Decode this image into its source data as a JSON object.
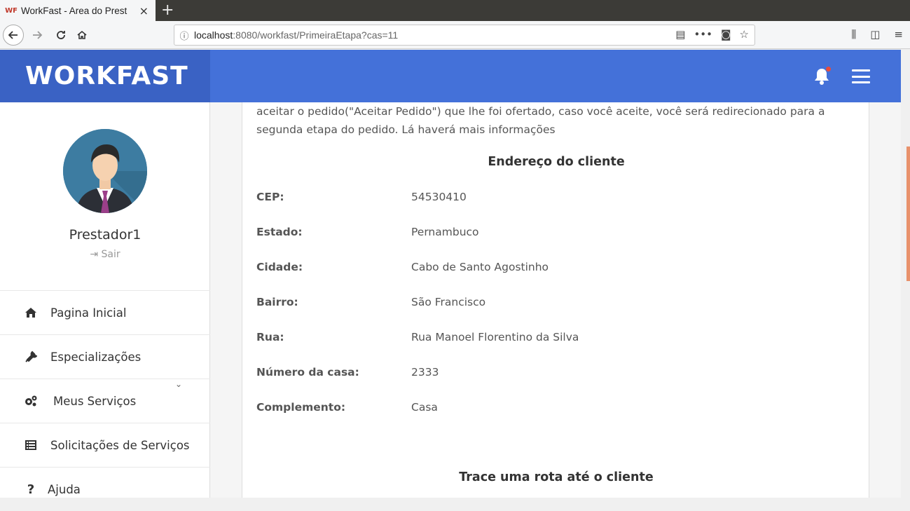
{
  "browser": {
    "tab_title": "WorkFast - Area do Prest",
    "tab_close": "×",
    "new_tab": "+",
    "url_host": "localhost",
    "url_path": ":8080/workfast/PrimeiraEtapa?cas=11"
  },
  "header": {
    "brand": "WORKFAST"
  },
  "sidebar": {
    "username": "Prestador1",
    "logout_label": "Sair",
    "items": [
      {
        "label": "Pagina Inicial",
        "icon": "home-icon"
      },
      {
        "label": "Especializações",
        "icon": "wrench-icon"
      },
      {
        "label": "Meus Serviços",
        "icon": "gears-icon"
      },
      {
        "label": "Solicitações de Serviços",
        "icon": "list-icon"
      },
      {
        "label": "Ajuda",
        "icon": "question-icon"
      }
    ]
  },
  "main": {
    "intro": "aceitar o pedido(\"Aceitar Pedido\") que lhe foi ofertado, caso você aceite, você será redirecionado para a segunda etapa do pedido. Lá haverá mais informações",
    "address_title": "Endereço do cliente",
    "fields": [
      {
        "label": "CEP:",
        "value": "54530410"
      },
      {
        "label": "Estado:",
        "value": "Pernambuco"
      },
      {
        "label": "Cidade:",
        "value": "Cabo de Santo Agostinho"
      },
      {
        "label": "Bairro:",
        "value": "São Francisco"
      },
      {
        "label": "Rua:",
        "value": "Rua Manoel Florentino da Silva"
      },
      {
        "label": "Número da casa:",
        "value": "2333"
      },
      {
        "label": "Complemento:",
        "value": "Casa"
      }
    ],
    "route_title": "Trace uma rota até o cliente"
  },
  "colors": {
    "header": "#4471d9",
    "brand_bg": "#3a62c4",
    "notification_dot": "#e74c3c"
  }
}
